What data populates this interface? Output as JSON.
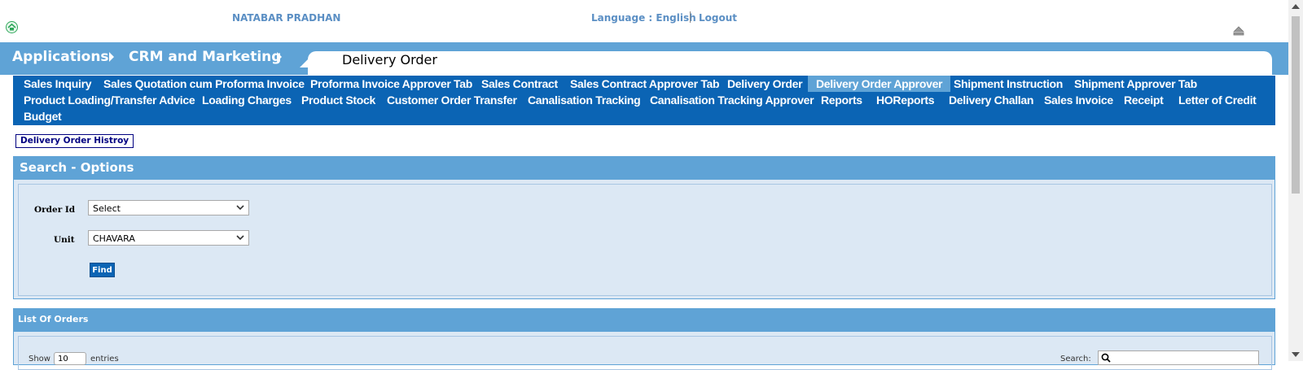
{
  "header": {
    "user_name": "NATABAR PRADHAN",
    "language": "Language : English",
    "logout": "Logout",
    "home_icon": "home-icon",
    "eject_icon": "eject-icon"
  },
  "breadcrumb": {
    "items": [
      "Applications",
      "CRM and Marketing"
    ],
    "page_title": "Delivery Order"
  },
  "nav": {
    "rows": [
      [
        "Sales Inquiry",
        "Sales Quotation cum Proforma Invoice",
        "Proforma Invoice Approver Tab",
        "Sales Contract",
        "Sales Contract Approver Tab",
        "Delivery Order",
        "Delivery Order Approver",
        "Shipment Instruction",
        "Shipment Approver Tab"
      ],
      [
        "Product Loading/Transfer Advice",
        "Loading Charges",
        "Product Stock",
        "Customer Order Transfer",
        "Canalisation Tracking",
        "Canalisation Tracking Approver",
        "Reports",
        "HOReports",
        "Delivery Challan",
        "Sales Invoice",
        "Receipt",
        "Letter of Credit"
      ],
      [
        "Budget"
      ]
    ],
    "active": "Delivery Order Approver"
  },
  "history_link": "Delivery Order Histroy",
  "search_options": {
    "title": "Search - Options",
    "order_id_label": "Order Id",
    "order_id_value": "Select",
    "unit_label": "Unit",
    "unit_value": "CHAVARA",
    "find_button": "Find"
  },
  "list": {
    "title": "List Of Orders",
    "show_label": "Show",
    "entries_value": "10",
    "entries_label": "entries",
    "search_label": "Search:"
  },
  "colors": {
    "nav_bg": "#0b64b4",
    "accent": "#5fa3d6",
    "panel_bg": "#dce8f4"
  }
}
